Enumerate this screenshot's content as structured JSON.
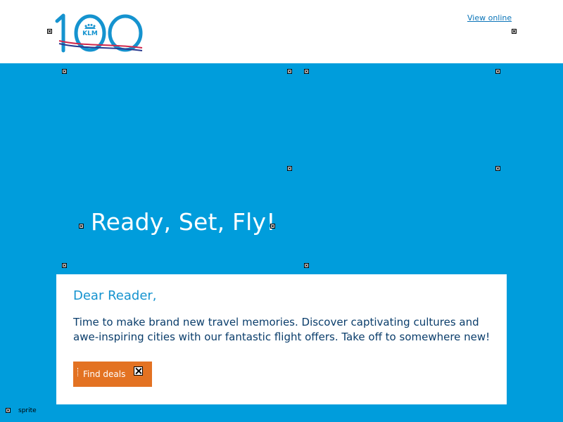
{
  "header": {
    "logo_text": "KLM",
    "view_online": "View online"
  },
  "hero": {
    "headline": "Ready, Set, Fly!"
  },
  "card": {
    "greeting": "Dear Reader,",
    "body": "Time to make brand new travel memories. Discover captivating cultures and awe-inspiring cities with our fantastic flight offers. Take off to somewhere new!",
    "cta_label": "Find deals"
  },
  "footer": {
    "alt_text": "sprite"
  },
  "colors": {
    "brand_blue": "#009ddc",
    "heading_blue": "#1593cf",
    "text_dark_blue": "#0a3d6b",
    "cta_orange": "#e37222",
    "white": "#ffffff"
  },
  "icons": [
    "klm-100-logo",
    "broken-image-icon"
  ]
}
